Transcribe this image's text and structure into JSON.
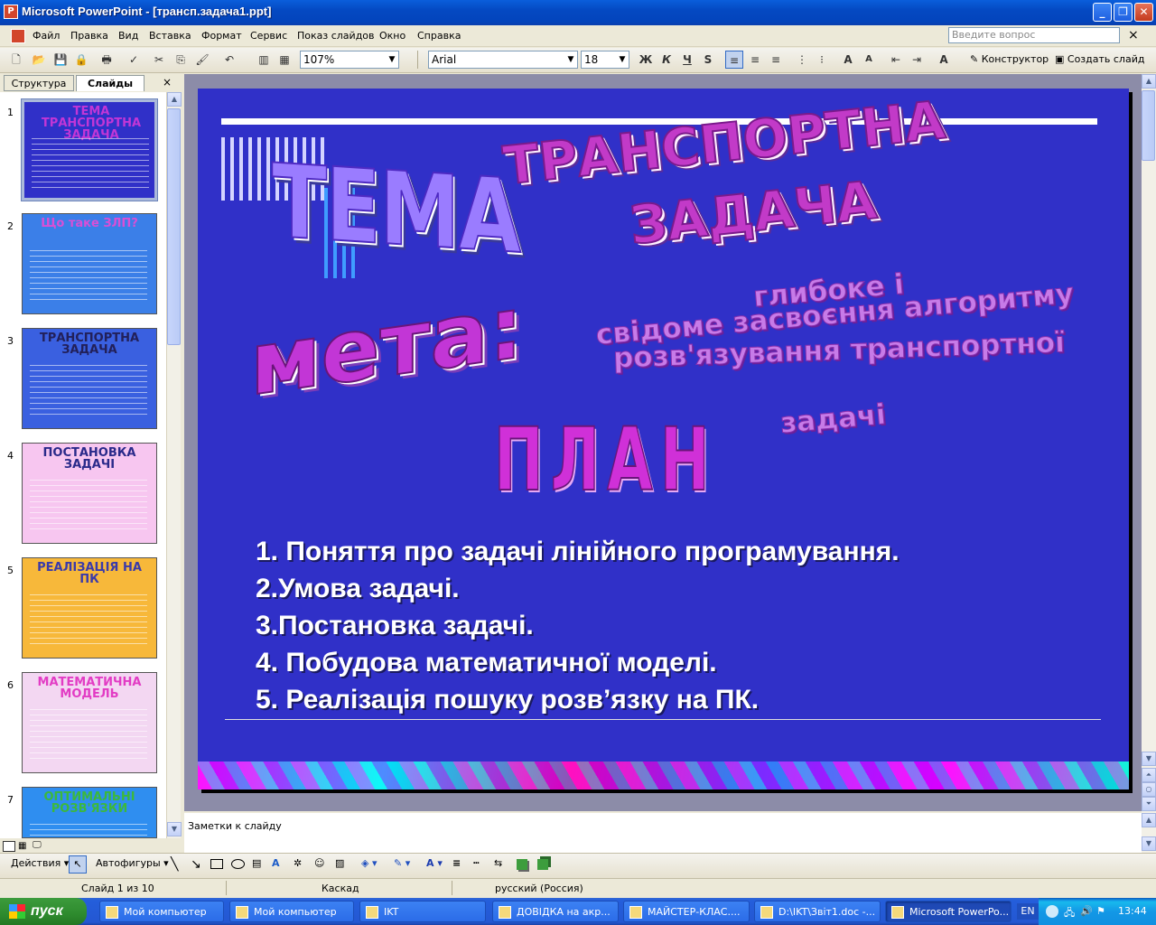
{
  "window": {
    "title": "Microsoft PowerPoint - [трансп.задача1.ppt]",
    "buttons": {
      "minimize": "_",
      "restore": "❐",
      "close": "✕"
    }
  },
  "menu": {
    "items": [
      "Файл",
      "Правка",
      "Вид",
      "Вставка",
      "Формат",
      "Сервис",
      "Показ слайдов",
      "Окно",
      "Справка"
    ],
    "ask_placeholder": "Введите вопрос",
    "close_doc": "×"
  },
  "toolbar": {
    "zoom": "107%",
    "font_name": "Arial",
    "font_size": "18",
    "bold": "Ж",
    "italic": "К",
    "underline": "Ч",
    "shadow": "S",
    "designer": "Конструктор",
    "new_slide": "Создать слайд"
  },
  "panel": {
    "tabs": [
      "Структура",
      "Слайды"
    ],
    "active_tab": "Слайды",
    "thumbnails": [
      {
        "num": "1",
        "title": "ТЕМА ТРАНСПОРТНА ЗАДАЧА",
        "bg": "#3030C8",
        "titlecolor": "#C236D6"
      },
      {
        "num": "2",
        "title": "Що таке ЗЛП?",
        "bg": "#3B7FE8",
        "titlecolor": "#D94FD6"
      },
      {
        "num": "3",
        "title": "ТРАНСПОРТНА ЗАДАЧА",
        "bg": "#3A60E0",
        "titlecolor": "#22205A"
      },
      {
        "num": "4",
        "title": "ПОСТАНОВКА ЗАДАЧІ",
        "bg": "#F7C6F0",
        "titlecolor": "#2A2A8A"
      },
      {
        "num": "5",
        "title": "РЕАЛІЗАЦІЯ НА ПК",
        "bg": "#F7B83A",
        "titlecolor": "#3A3AAA"
      },
      {
        "num": "6",
        "title": "МАТЕМАТИЧНА МОДЕЛЬ",
        "bg": "#F3D7F2",
        "titlecolor": "#E23CC4"
      },
      {
        "num": "7",
        "title": "ОПТИМАЛЬНІ РОЗВ'ЯЗКИ",
        "bg": "#2F8EF0",
        "titlecolor": "#3CB83C"
      }
    ]
  },
  "slide": {
    "tema": "ТЕМА",
    "topic_line1": "ТРАНСПОРТНА",
    "topic_line2": "ЗАДАЧА",
    "goal_label": "мета:",
    "goal_text": [
      "глибоке і",
      "свідоме засвоєння алгоритму",
      "розв'язування транспортної",
      "задачі"
    ],
    "plan_label": "ПЛАН",
    "plan_items": [
      "1. Поняття про задачі лінійного програмування.",
      "2.Умова задачі.",
      "3.Постановка задачі.",
      "4.  Побудова математичної моделі.",
      "5.  Реалізація пошуку розв’язку на  ПК."
    ]
  },
  "notes": {
    "placeholder": "Заметки к слайду"
  },
  "drawbar": {
    "actions": "Действия",
    "autoshapes": "Автофигуры"
  },
  "status": {
    "slide": "Слайд 1 из 10",
    "design": "Каскад",
    "language": "русский (Россия)"
  },
  "taskbar": {
    "start": "пуск",
    "tasks": [
      {
        "label": "Мой компьютер",
        "active": false
      },
      {
        "label": "Мой компьютер",
        "active": false
      },
      {
        "label": "IKT",
        "active": false
      },
      {
        "label": "ДОВІДКА на акр...",
        "active": false
      },
      {
        "label": "МАЙСТЕР-КЛАС....",
        "active": false
      },
      {
        "label": "D:\\IKT\\Звіт1.doc -...",
        "active": false
      },
      {
        "label": "Microsoft PowerPo...",
        "active": true
      }
    ],
    "lang": "EN",
    "clock": "13:44"
  }
}
